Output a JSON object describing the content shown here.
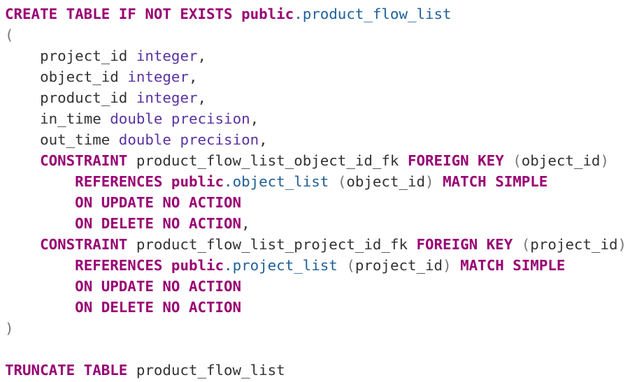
{
  "colors": {
    "keyword": "#990073",
    "type": "#5a32a3",
    "table": "#1f5f99",
    "plain": "#333333",
    "punctuation": "#777777",
    "background": "#ffffff"
  },
  "lines": [
    {
      "indent": "",
      "tokens": [
        {
          "t": "CREATE TABLE IF NOT EXISTS",
          "c": "kw"
        },
        {
          "t": " ",
          "c": "pl"
        },
        {
          "t": "public",
          "c": "kw"
        },
        {
          "t": ".product_flow_list",
          "c": "tb"
        }
      ]
    },
    {
      "indent": "",
      "tokens": [
        {
          "t": "(",
          "c": "pu"
        }
      ]
    },
    {
      "indent": "    ",
      "tokens": [
        {
          "t": "project_id",
          "c": "pl"
        },
        {
          "t": " ",
          "c": "pl"
        },
        {
          "t": "integer",
          "c": "ty"
        },
        {
          "t": ",",
          "c": "pl"
        }
      ]
    },
    {
      "indent": "    ",
      "tokens": [
        {
          "t": "object_id",
          "c": "pl"
        },
        {
          "t": " ",
          "c": "pl"
        },
        {
          "t": "integer",
          "c": "ty"
        },
        {
          "t": ",",
          "c": "pl"
        }
      ]
    },
    {
      "indent": "    ",
      "tokens": [
        {
          "t": "product_id",
          "c": "pl"
        },
        {
          "t": " ",
          "c": "pl"
        },
        {
          "t": "integer",
          "c": "ty"
        },
        {
          "t": ",",
          "c": "pl"
        }
      ]
    },
    {
      "indent": "    ",
      "tokens": [
        {
          "t": "in_time",
          "c": "pl"
        },
        {
          "t": " ",
          "c": "pl"
        },
        {
          "t": "double precision",
          "c": "ty"
        },
        {
          "t": ",",
          "c": "pl"
        }
      ]
    },
    {
      "indent": "    ",
      "tokens": [
        {
          "t": "out_time",
          "c": "pl"
        },
        {
          "t": " ",
          "c": "pl"
        },
        {
          "t": "double precision",
          "c": "ty"
        },
        {
          "t": ",",
          "c": "pl"
        }
      ]
    },
    {
      "indent": "    ",
      "tokens": [
        {
          "t": "CONSTRAINT",
          "c": "kw"
        },
        {
          "t": " product_flow_list_object_id_fk ",
          "c": "pl"
        },
        {
          "t": "FOREIGN KEY",
          "c": "kw"
        },
        {
          "t": " (",
          "c": "pu"
        },
        {
          "t": "object_id",
          "c": "pl"
        },
        {
          "t": ")",
          "c": "pu"
        }
      ]
    },
    {
      "indent": "        ",
      "tokens": [
        {
          "t": "REFERENCES",
          "c": "kw"
        },
        {
          "t": " ",
          "c": "pl"
        },
        {
          "t": "public",
          "c": "kw"
        },
        {
          "t": ".object_list",
          "c": "tb"
        },
        {
          "t": " (",
          "c": "pu"
        },
        {
          "t": "object_id",
          "c": "pl"
        },
        {
          "t": ") ",
          "c": "pu"
        },
        {
          "t": "MATCH SIMPLE",
          "c": "kw"
        }
      ]
    },
    {
      "indent": "        ",
      "tokens": [
        {
          "t": "ON UPDATE NO ACTION",
          "c": "kw"
        }
      ]
    },
    {
      "indent": "        ",
      "tokens": [
        {
          "t": "ON DELETE NO ACTION",
          "c": "kw"
        },
        {
          "t": ",",
          "c": "pl"
        }
      ]
    },
    {
      "indent": "    ",
      "tokens": [
        {
          "t": "CONSTRAINT",
          "c": "kw"
        },
        {
          "t": " product_flow_list_project_id_fk ",
          "c": "pl"
        },
        {
          "t": "FOREIGN KEY",
          "c": "kw"
        },
        {
          "t": " (",
          "c": "pu"
        },
        {
          "t": "project_id",
          "c": "pl"
        },
        {
          "t": ")",
          "c": "pu"
        }
      ]
    },
    {
      "indent": "        ",
      "tokens": [
        {
          "t": "REFERENCES",
          "c": "kw"
        },
        {
          "t": " ",
          "c": "pl"
        },
        {
          "t": "public",
          "c": "kw"
        },
        {
          "t": ".project_list",
          "c": "tb"
        },
        {
          "t": " (",
          "c": "pu"
        },
        {
          "t": "project_id",
          "c": "pl"
        },
        {
          "t": ") ",
          "c": "pu"
        },
        {
          "t": "MATCH SIMPLE",
          "c": "kw"
        }
      ]
    },
    {
      "indent": "        ",
      "tokens": [
        {
          "t": "ON UPDATE NO ACTION",
          "c": "kw"
        }
      ]
    },
    {
      "indent": "        ",
      "tokens": [
        {
          "t": "ON DELETE NO ACTION",
          "c": "kw"
        }
      ]
    },
    {
      "indent": "",
      "tokens": [
        {
          "t": ")",
          "c": "pu"
        }
      ]
    },
    {
      "indent": "",
      "tokens": []
    },
    {
      "indent": "",
      "tokens": [
        {
          "t": "TRUNCATE TABLE",
          "c": "kw"
        },
        {
          "t": " product_flow_list",
          "c": "pl"
        }
      ]
    }
  ]
}
